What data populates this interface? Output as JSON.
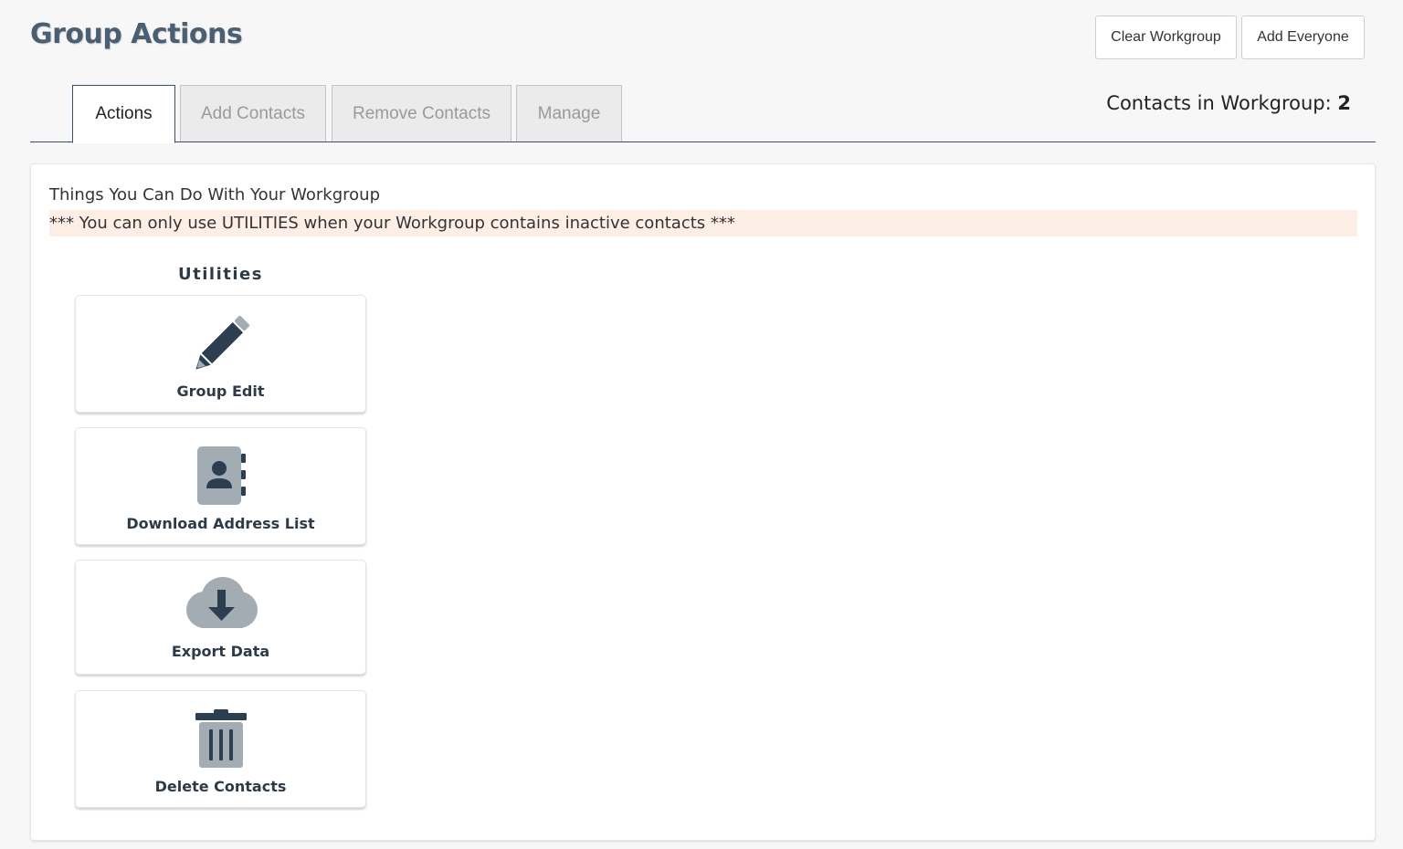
{
  "header": {
    "title": "Group Actions",
    "clear_workgroup_label": "Clear Workgroup",
    "add_everyone_label": "Add Everyone"
  },
  "tabs": [
    {
      "label": "Actions",
      "active": true
    },
    {
      "label": "Add Contacts",
      "active": false
    },
    {
      "label": "Remove Contacts",
      "active": false
    },
    {
      "label": "Manage",
      "active": false
    }
  ],
  "workgroup": {
    "count_label": "Contacts in Workgroup:",
    "count": "2"
  },
  "panel": {
    "heading": "Things You Can Do With Your Workgroup",
    "warning": "*** You can only use UTILITIES when your Workgroup contains inactive contacts ***",
    "section_title": "Utilities",
    "utilities": [
      {
        "label": "Group Edit",
        "icon": "pencil-icon"
      },
      {
        "label": "Download Address List",
        "icon": "address-book-icon"
      },
      {
        "label": "Export Data",
        "icon": "cloud-download-icon"
      },
      {
        "label": "Delete Contacts",
        "icon": "trash-icon"
      }
    ]
  },
  "colors": {
    "title": "#4a5f72",
    "icon_dark": "#2d3e50",
    "icon_light": "#a3abb3",
    "warning_bg": "#fdeee6",
    "tab_border_active": "#3a4f63"
  }
}
